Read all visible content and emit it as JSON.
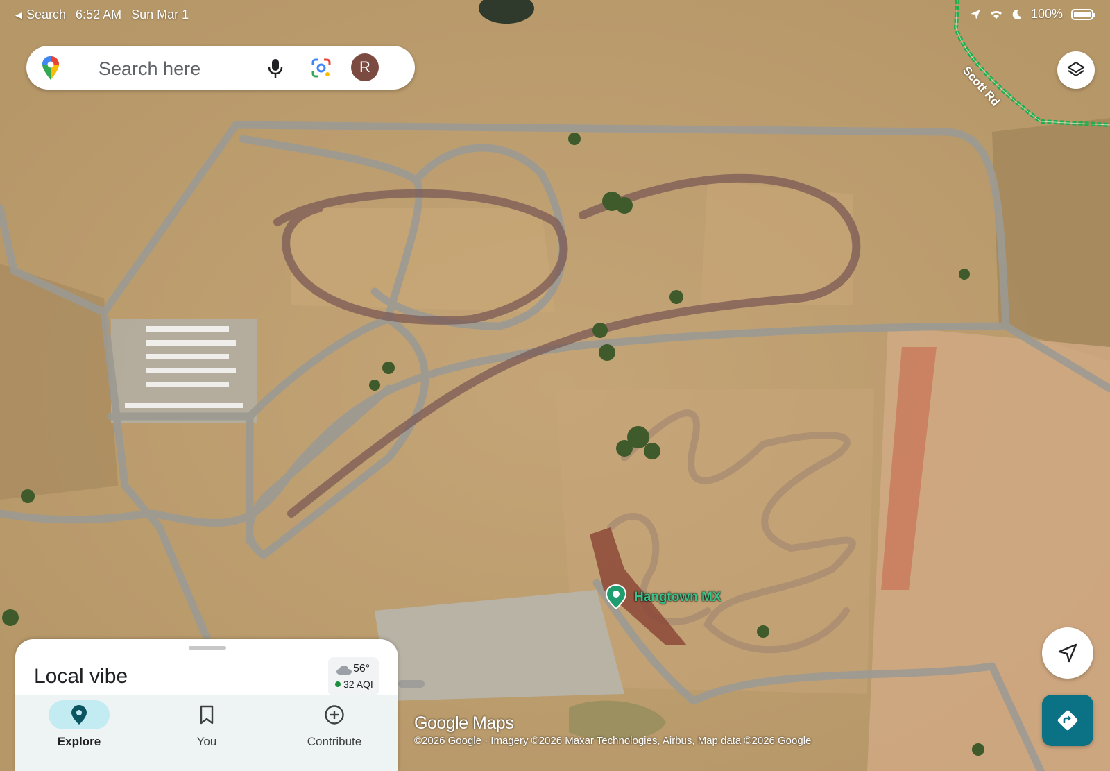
{
  "status_bar": {
    "back_label": "Search",
    "time": "6:52 AM",
    "date": "Sun Mar 1",
    "battery": "100%"
  },
  "search": {
    "placeholder": "Search here",
    "avatar_initial": "R"
  },
  "map": {
    "road_label": "Scott Rd",
    "place_label": "Hangtown MX",
    "logo": "Google Maps",
    "copyright": "©2026 Google · Imagery ©2026 Maxar Technologies, Airbus, Map data ©2026 Google"
  },
  "sheet": {
    "title": "Local vibe",
    "weather_temp": "56°",
    "weather_aqi": "32 AQI"
  },
  "nav": {
    "items": [
      {
        "label": "Explore",
        "icon": "location-pin-icon"
      },
      {
        "label": "You",
        "icon": "bookmark-icon"
      },
      {
        "label": "Contribute",
        "icon": "add-circle-icon"
      }
    ]
  },
  "colors": {
    "accent": "#0b7285",
    "place_label": "#34c48a",
    "aqi_good": "#1e8e3e",
    "active_nav_bg": "#c2ecf1",
    "road_green": "#1fae4b"
  },
  "icons": [
    "location-arrow-icon",
    "wifi-icon",
    "moon-icon",
    "battery-icon",
    "maps-pin-icon",
    "mic-icon",
    "lens-icon",
    "layers-icon",
    "navigate-icon",
    "directions-icon",
    "cloud-icon"
  ]
}
